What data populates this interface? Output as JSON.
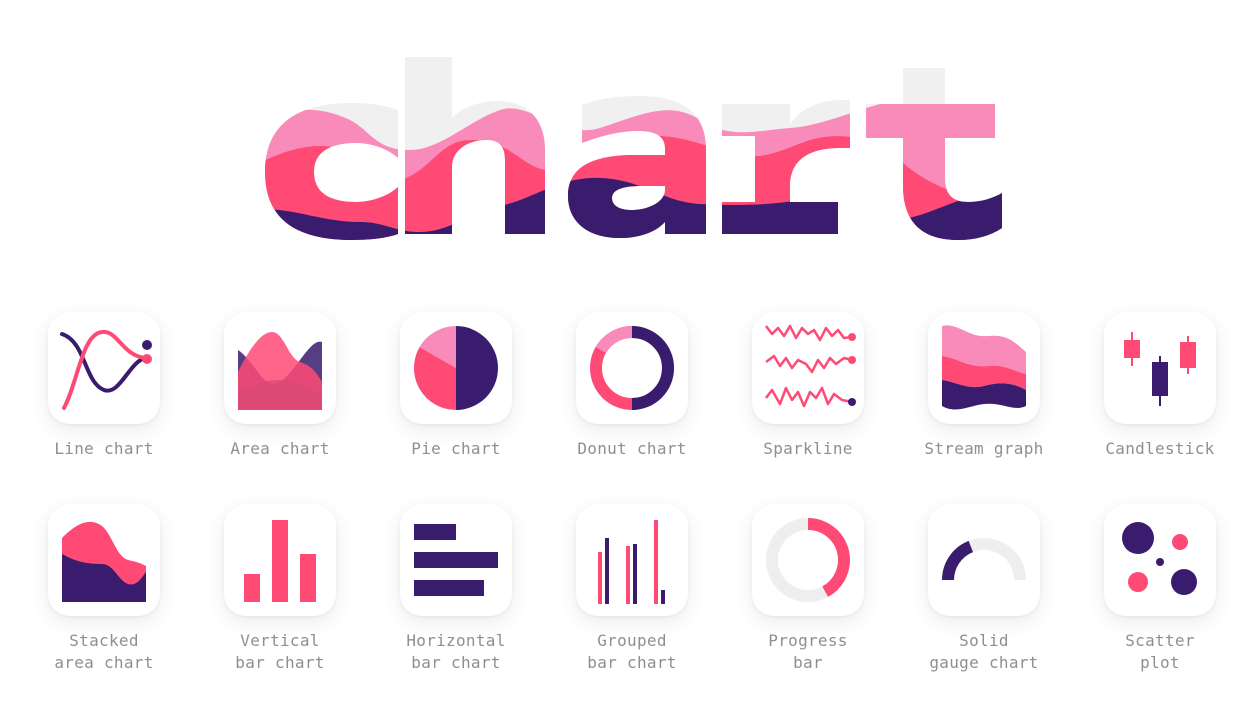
{
  "title": "chart",
  "colors": {
    "purple": "#3a1c6e",
    "red": "#ff4a75",
    "pink": "#f98bbb",
    "gray": "#eeeeee",
    "label": "#8f8f8f"
  },
  "tiles": [
    {
      "icon": "line-chart-icon",
      "line1": "Line chart",
      "line2": ""
    },
    {
      "icon": "area-chart-icon",
      "line1": "Area chart",
      "line2": ""
    },
    {
      "icon": "pie-chart-icon",
      "line1": "Pie chart",
      "line2": ""
    },
    {
      "icon": "donut-chart-icon",
      "line1": "Donut chart",
      "line2": ""
    },
    {
      "icon": "sparkline-icon",
      "line1": "Sparkline",
      "line2": ""
    },
    {
      "icon": "stream-graph-icon",
      "line1": "Stream graph",
      "line2": ""
    },
    {
      "icon": "candlestick-icon",
      "line1": "Candlestick",
      "line2": ""
    },
    {
      "icon": "stacked-area-chart-icon",
      "line1": "Stacked",
      "line2": "area chart"
    },
    {
      "icon": "vertical-bar-chart-icon",
      "line1": "Vertical",
      "line2": "bar chart"
    },
    {
      "icon": "horizontal-bar-chart-icon",
      "line1": "Horizontal",
      "line2": "bar chart"
    },
    {
      "icon": "grouped-bar-chart-icon",
      "line1": "Grouped",
      "line2": "bar chart"
    },
    {
      "icon": "progress-bar-icon",
      "line1": "Progress",
      "line2": "bar",
      "progress": 0.42
    },
    {
      "icon": "solid-gauge-chart-icon",
      "line1": "Solid",
      "line2": "gauge chart",
      "gauge": 0.38
    },
    {
      "icon": "scatter-plot-icon",
      "line1": "Scatter",
      "line2": "plot"
    }
  ]
}
